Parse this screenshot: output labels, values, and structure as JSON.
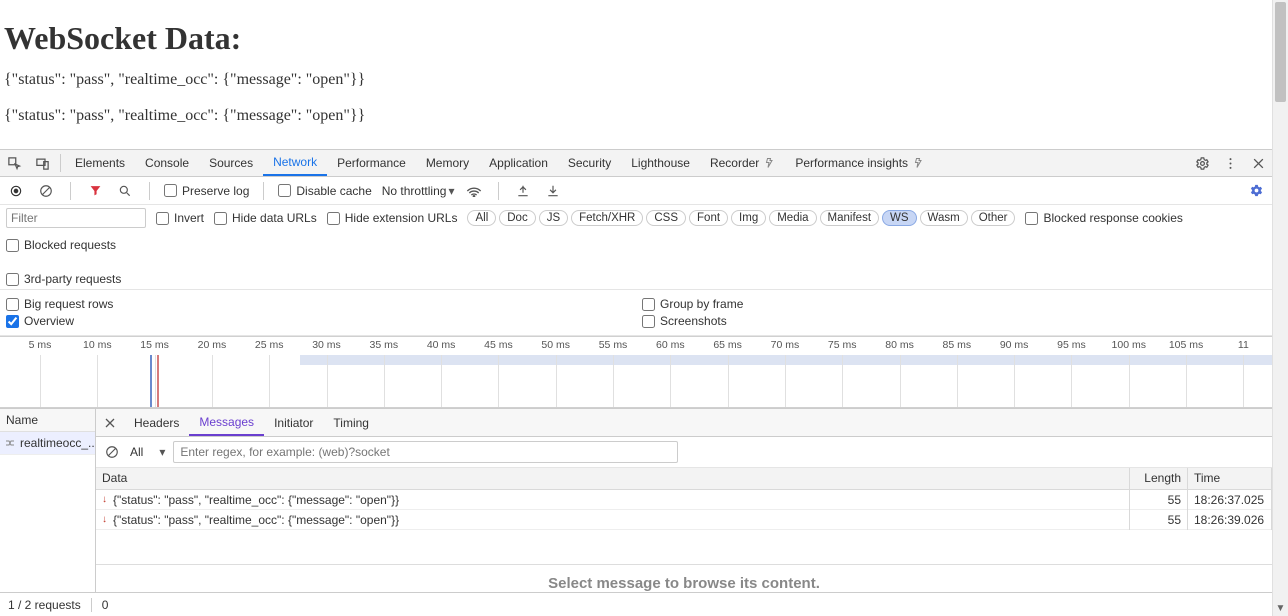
{
  "page": {
    "title": "WebSocket Data:",
    "lines": [
      "{\"status\": \"pass\", \"realtime_occ\": {\"message\": \"open\"}}",
      "{\"status\": \"pass\", \"realtime_occ\": {\"message\": \"open\"}}"
    ]
  },
  "devtools": {
    "tabs": {
      "elements": "Elements",
      "console": "Console",
      "sources": "Sources",
      "network": "Network",
      "performance": "Performance",
      "memory": "Memory",
      "application": "Application",
      "security": "Security",
      "lighthouse": "Lighthouse",
      "recorder": "Recorder",
      "perf_insights": "Performance insights"
    },
    "toolbar": {
      "preserve_log": "Preserve log",
      "disable_cache": "Disable cache",
      "throttling": "No throttling"
    },
    "filter": {
      "placeholder": "Filter",
      "invert": "Invert",
      "hide_data_urls": "Hide data URLs",
      "hide_ext_urls": "Hide extension URLs",
      "blocked_cookies": "Blocked response cookies",
      "blocked_requests": "Blocked requests",
      "third_party": "3rd-party requests",
      "types": {
        "all": "All",
        "doc": "Doc",
        "js": "JS",
        "fetch": "Fetch/XHR",
        "css": "CSS",
        "font": "Font",
        "img": "Img",
        "media": "Media",
        "manifest": "Manifest",
        "ws": "WS",
        "wasm": "Wasm",
        "other": "Other"
      }
    },
    "options": {
      "big_rows": "Big request rows",
      "overview": "Overview",
      "group_frame": "Group by frame",
      "screenshots": "Screenshots"
    },
    "timeline": {
      "ticks": [
        "5 ms",
        "10 ms",
        "15 ms",
        "20 ms",
        "25 ms",
        "30 ms",
        "35 ms",
        "40 ms",
        "45 ms",
        "50 ms",
        "55 ms",
        "60 ms",
        "65 ms",
        "70 ms",
        "75 ms",
        "80 ms",
        "85 ms",
        "90 ms",
        "95 ms",
        "100 ms",
        "105 ms",
        "11"
      ]
    },
    "requests": {
      "header": "Name",
      "items": [
        {
          "name": "realtimeocc_..."
        }
      ]
    },
    "detail": {
      "tabs": {
        "headers": "Headers",
        "messages": "Messages",
        "initiator": "Initiator",
        "timing": "Timing"
      },
      "msg_filter_placeholder": "Enter regex, for example: (web)?socket",
      "msg_type_selected": "All",
      "columns": {
        "data": "Data",
        "length": "Length",
        "time": "Time"
      },
      "rows": [
        {
          "dir": "down",
          "data": "{\"status\": \"pass\", \"realtime_occ\": {\"message\": \"open\"}}",
          "length": "55",
          "time": "18:26:37.025"
        },
        {
          "dir": "down",
          "data": "{\"status\": \"pass\", \"realtime_occ\": {\"message\": \"open\"}}",
          "length": "55",
          "time": "18:26:39.026"
        }
      ],
      "placeholder": "Select message to browse its content."
    },
    "status": {
      "requests": "1 / 2 requests",
      "bytes": "0"
    }
  }
}
